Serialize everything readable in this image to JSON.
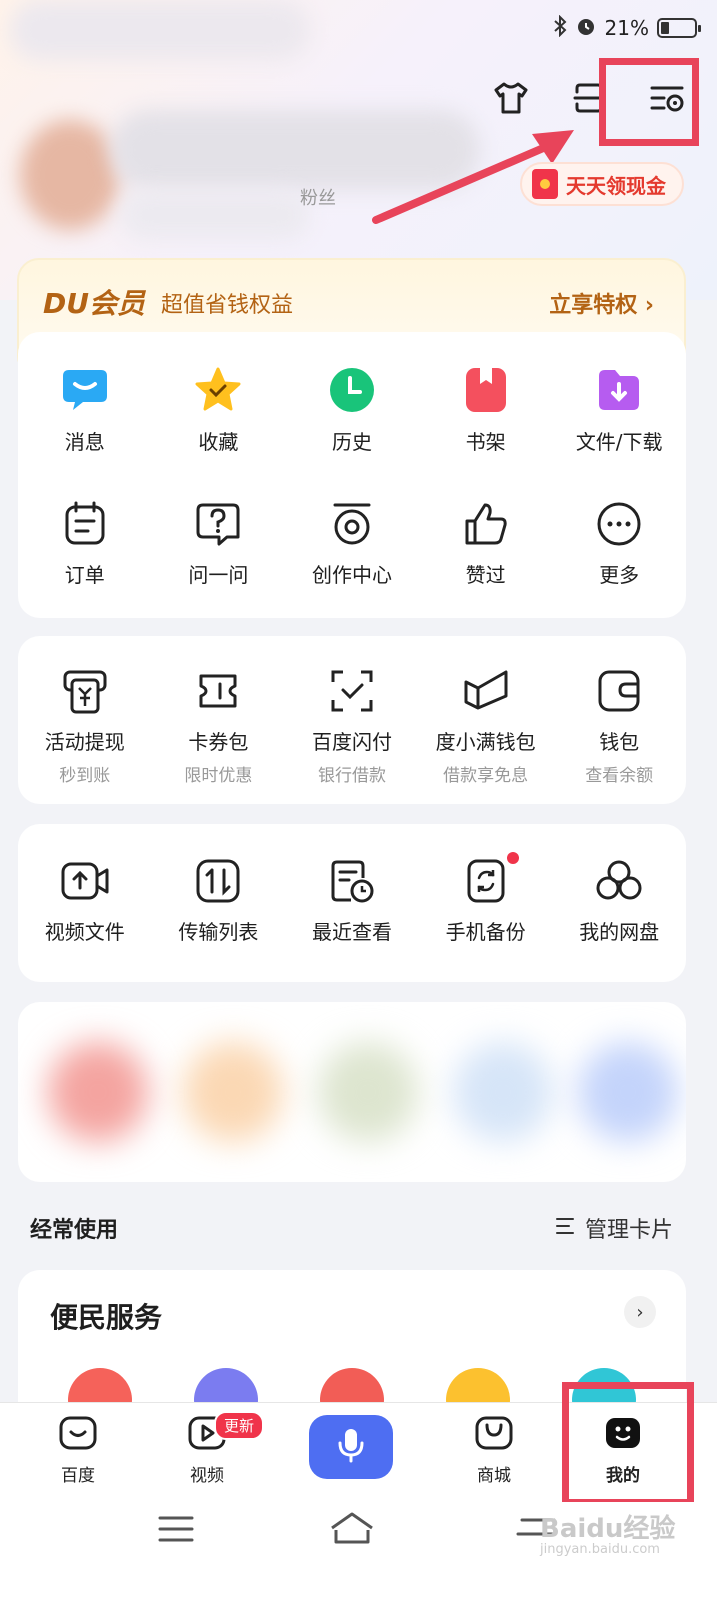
{
  "status_bar": {
    "battery": "21%"
  },
  "profile": {
    "fans_label": "粉丝"
  },
  "cash_button": {
    "label": "天天领现金"
  },
  "vip": {
    "logo": "DU会员",
    "subtitle": "超值省钱权益",
    "cta": "立享特权 ›"
  },
  "quick_grid": [
    {
      "label": "消息",
      "icon": "message-icon",
      "color": "#2aa9f4"
    },
    {
      "label": "收藏",
      "icon": "star-icon",
      "color": "#ffc01e"
    },
    {
      "label": "历史",
      "icon": "clock-icon",
      "color": "#19c47a"
    },
    {
      "label": "书架",
      "icon": "bookshelf-icon",
      "color": "#f4505e"
    },
    {
      "label": "文件/下载",
      "icon": "folder-download-icon",
      "color": "#b65cf0"
    },
    {
      "label": "订单",
      "icon": "order-icon"
    },
    {
      "label": "问一问",
      "icon": "question-icon"
    },
    {
      "label": "创作中心",
      "icon": "creator-icon"
    },
    {
      "label": "赞过",
      "icon": "thumbs-up-icon"
    },
    {
      "label": "更多",
      "icon": "more-icon"
    }
  ],
  "finance": [
    {
      "label": "活动提现",
      "sub": "秒到账"
    },
    {
      "label": "卡券包",
      "sub": "限时优惠"
    },
    {
      "label": "百度闪付",
      "sub": "银行借款"
    },
    {
      "label": "度小满钱包",
      "sub": "借款享免息"
    },
    {
      "label": "钱包",
      "sub": "查看余额"
    }
  ],
  "netdisk": [
    {
      "label": "视频文件"
    },
    {
      "label": "传输列表"
    },
    {
      "label": "最近查看"
    },
    {
      "label": "手机备份"
    },
    {
      "label": "我的网盘"
    }
  ],
  "frequent": {
    "title": "经常使用",
    "manage": "管理卡片"
  },
  "service": {
    "title": "便民服务"
  },
  "tabs": [
    {
      "label": "百度"
    },
    {
      "label": "视频",
      "badge": "更新"
    },
    {
      "label": "商城"
    },
    {
      "label": "我的"
    }
  ],
  "watermark": {
    "text": "Baidu经验",
    "sub": "jingyan.baidu.com"
  }
}
